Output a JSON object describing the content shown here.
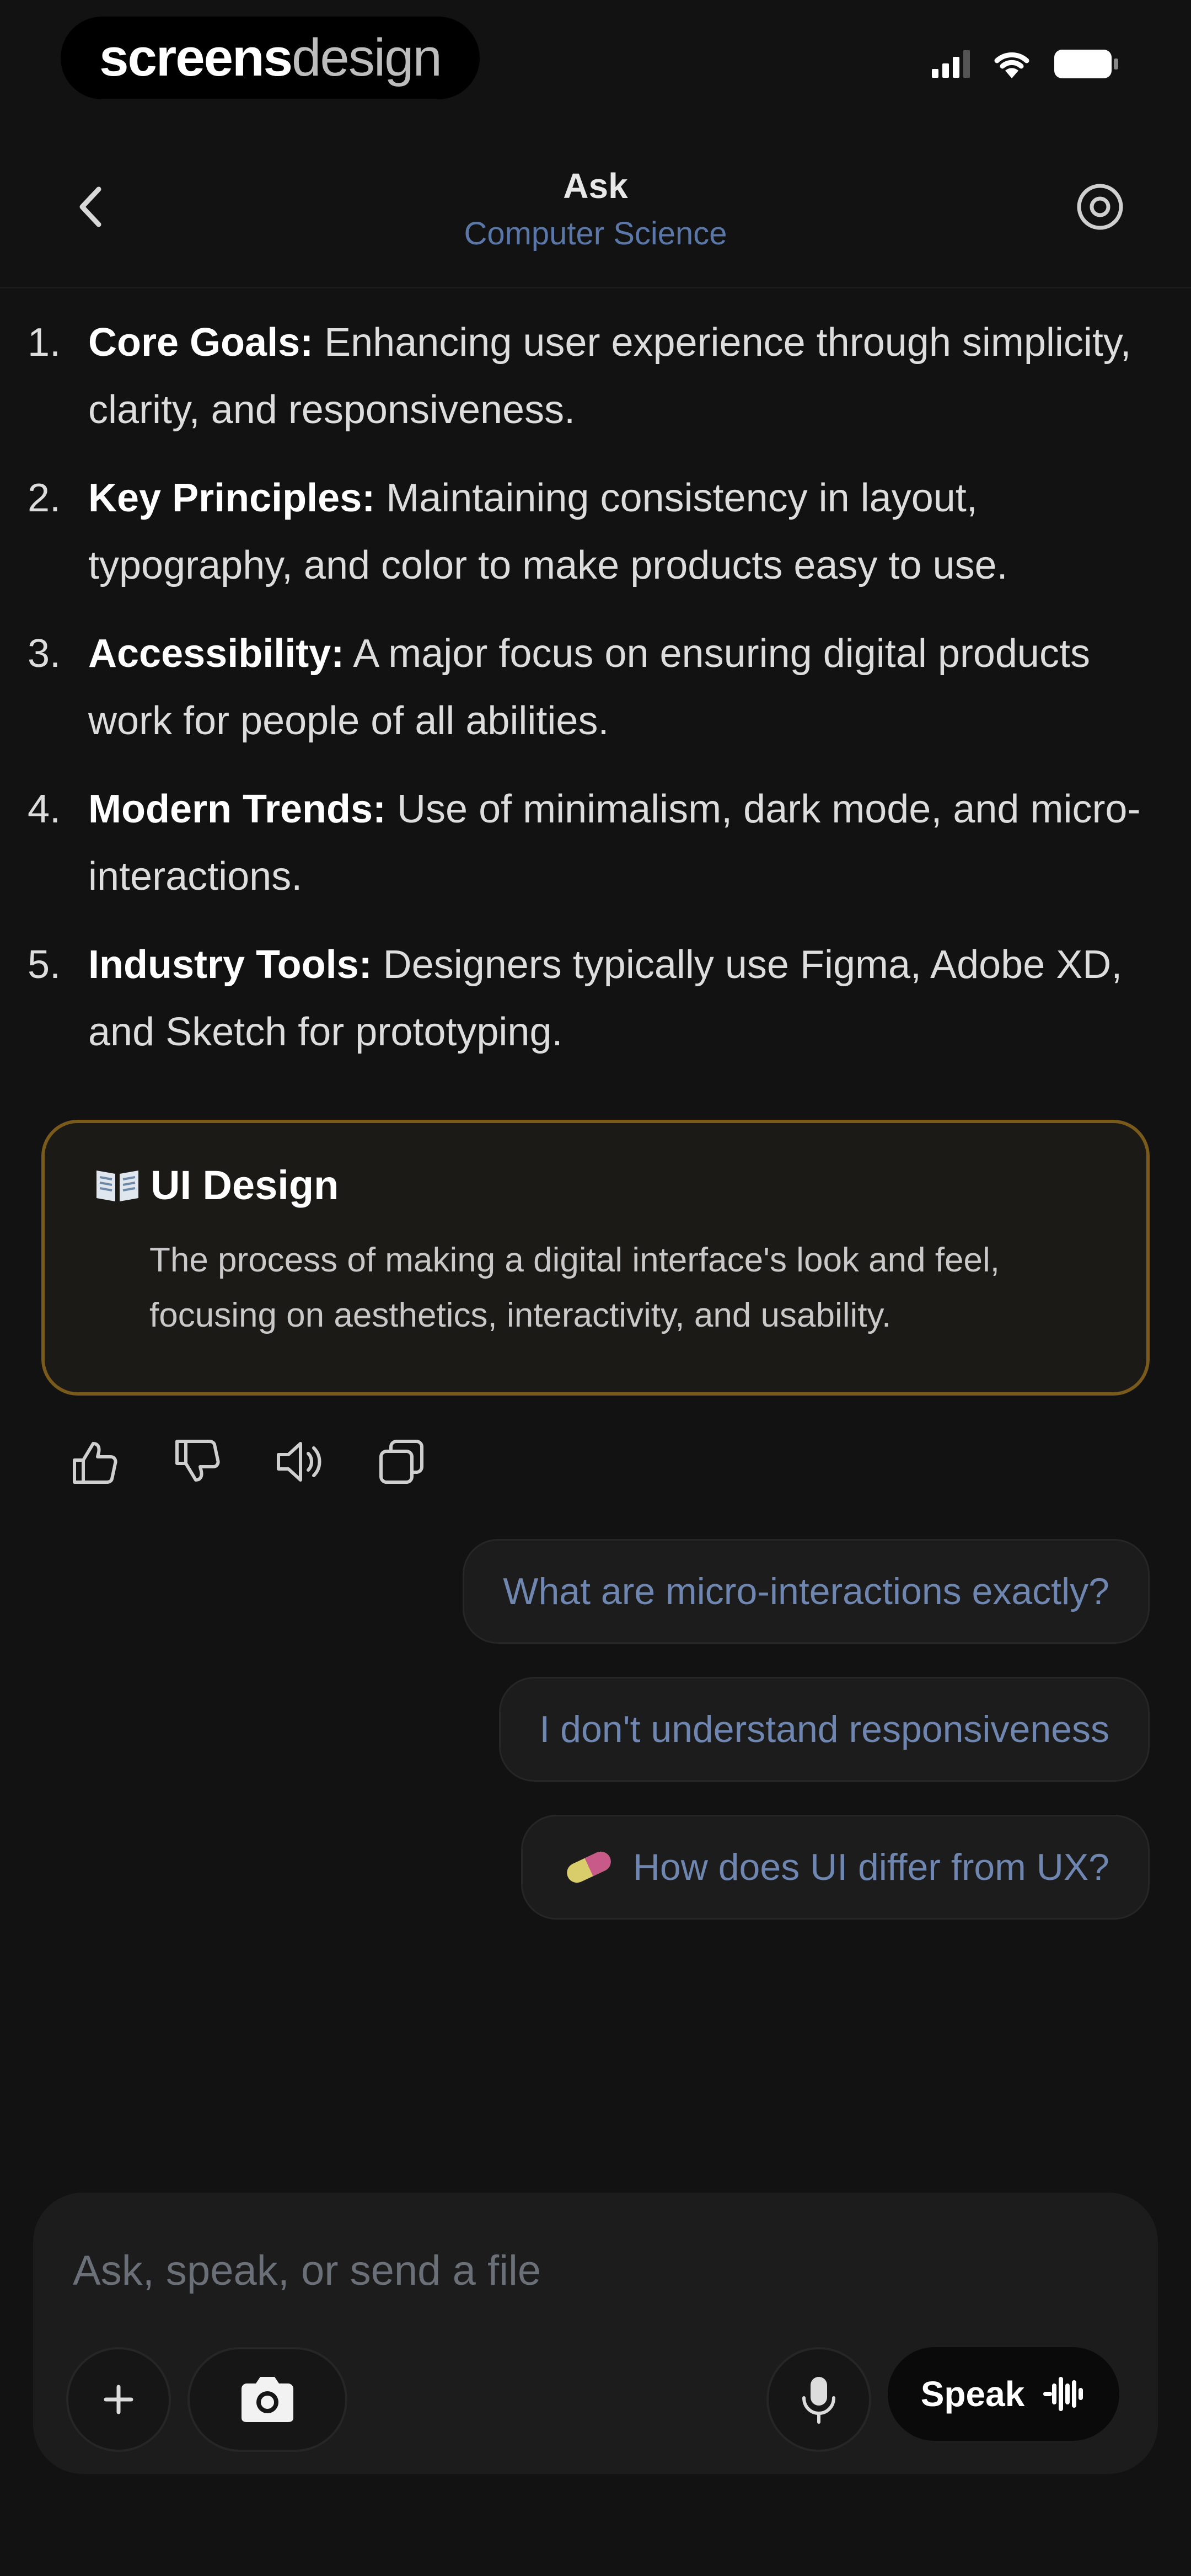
{
  "status_bar": {
    "brand_left": "screens",
    "brand_right": "design",
    "icons": [
      "signal-icon",
      "wifi-icon",
      "battery-icon"
    ]
  },
  "nav": {
    "title": "Ask",
    "subtitle": "Computer Science",
    "back_icon": "chevron-left-icon",
    "settings_icon": "settings-icon"
  },
  "points": [
    {
      "number": "1.",
      "term": "Core Goals:",
      "text": " Enhancing user experience through simplicity, clarity, and responsiveness."
    },
    {
      "number": "2.",
      "term": "Key Principles:",
      "text": " Maintaining consistency in layout, typography, and color to make products easy to use."
    },
    {
      "number": "3.",
      "term": "Accessibility:",
      "text": " A major focus on ensuring digital products work for people of all abilities."
    },
    {
      "number": "4.",
      "term": "Modern Trends:",
      "text": " Use of minimalism, dark mode, and micro-interactions."
    },
    {
      "number": "5.",
      "term": "Industry Tools:",
      "text": " Designers typically use Figma, Adobe XD, and Sketch for prototyping."
    }
  ],
  "definition": {
    "icon": "book-icon",
    "title": "UI Design",
    "body": "The process of making a digital interface's look and feel, focusing on aesthetics, interactivity, and usability."
  },
  "actions": [
    "thumbs-up-icon",
    "thumbs-down-icon",
    "speaker-icon",
    "copy-icon"
  ],
  "suggestions": [
    {
      "label": "What are micro-interactions exactly?"
    },
    {
      "label": "I don't understand responsiveness"
    },
    {
      "label": "How does UI differ from UX?",
      "icon": "pill-icon"
    }
  ],
  "composer": {
    "placeholder": "Ask, speak, or send a file",
    "speak_label": "Speak",
    "icons": [
      "plus-icon",
      "camera-icon",
      "microphone-icon",
      "waveform-icon"
    ]
  },
  "colors": {
    "background": "#121212",
    "card_border": "#7a5a1a",
    "link_blue": "#6e86b0"
  }
}
